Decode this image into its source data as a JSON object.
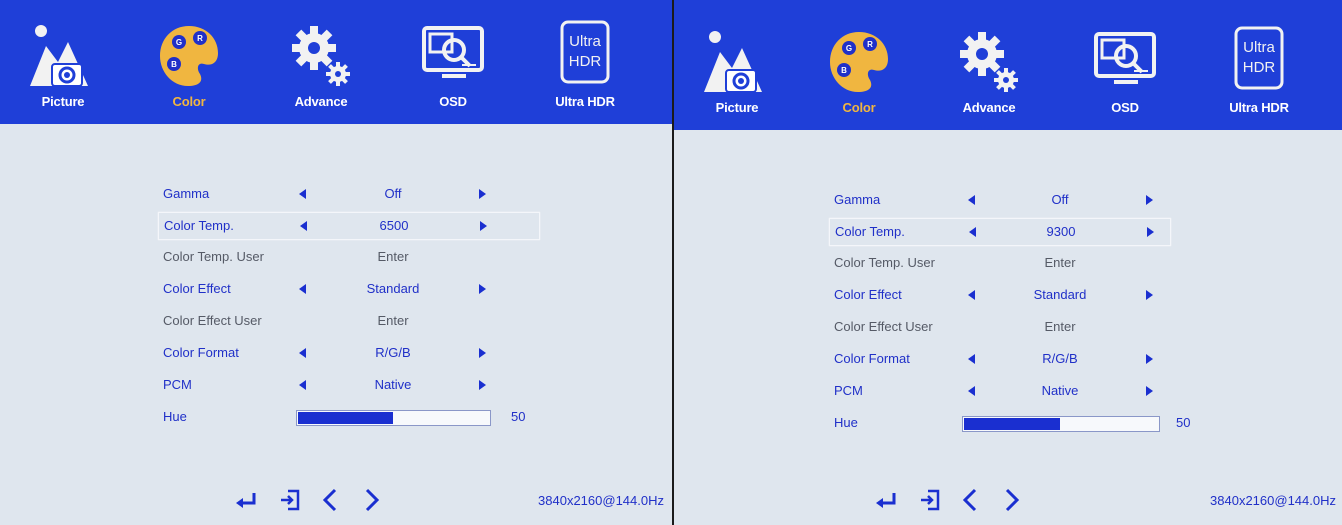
{
  "colors": {
    "accent": "#1f3fd8",
    "active_tab": "#f0b640",
    "text_blue": "#2030c8",
    "text_gray": "#555a66",
    "bg": "#dfe6ee"
  },
  "left": {
    "tabs": [
      {
        "label": "Picture",
        "icon": "picture-icon"
      },
      {
        "label": "Color",
        "icon": "palette-icon",
        "active": true
      },
      {
        "label": "Advance",
        "icon": "gears-icon"
      },
      {
        "label": "OSD",
        "icon": "monitor-search-icon"
      },
      {
        "label": "Ultra HDR",
        "icon": "ultra-hdr-icon",
        "badge_line1": "Ultra",
        "badge_line2": "HDR"
      }
    ],
    "menu": [
      {
        "label": "Gamma",
        "value": "Off"
      },
      {
        "label": "Color Temp.",
        "value": "6500"
      },
      {
        "label": "Color Temp. User",
        "value": "Enter"
      },
      {
        "label": "Color Effect",
        "value": "Standard"
      },
      {
        "label": "Color Effect User",
        "value": "Enter"
      },
      {
        "label": "Color Format",
        "value": "R/G/B"
      },
      {
        "label": "PCM",
        "value": "Native"
      },
      {
        "label": "Hue",
        "value": "50",
        "level": 0.5
      }
    ],
    "resolution": "3840x2160@144.0Hz"
  },
  "right": {
    "tabs": [
      {
        "label": "Picture",
        "icon": "picture-icon"
      },
      {
        "label": "Color",
        "icon": "palette-icon",
        "active": true
      },
      {
        "label": "Advance",
        "icon": "gears-icon"
      },
      {
        "label": "OSD",
        "icon": "monitor-search-icon"
      },
      {
        "label": "Ultra HDR",
        "icon": "ultra-hdr-icon",
        "badge_line1": "Ultra",
        "badge_line2": "HDR"
      }
    ],
    "menu": [
      {
        "label": "Gamma",
        "value": "Off"
      },
      {
        "label": "Color Temp.",
        "value": "9300"
      },
      {
        "label": "Color Temp. User",
        "value": "Enter"
      },
      {
        "label": "Color Effect",
        "value": "Standard"
      },
      {
        "label": "Color Effect User",
        "value": "Enter"
      },
      {
        "label": "Color Format",
        "value": "R/G/B"
      },
      {
        "label": "PCM",
        "value": "Native"
      },
      {
        "label": "Hue",
        "value": "50",
        "level": 0.5
      }
    ],
    "resolution": "3840x2160@144.0Hz"
  },
  "bottom_icons": [
    "enter-icon",
    "exit-icon",
    "chevron-left-icon",
    "chevron-right-icon"
  ]
}
